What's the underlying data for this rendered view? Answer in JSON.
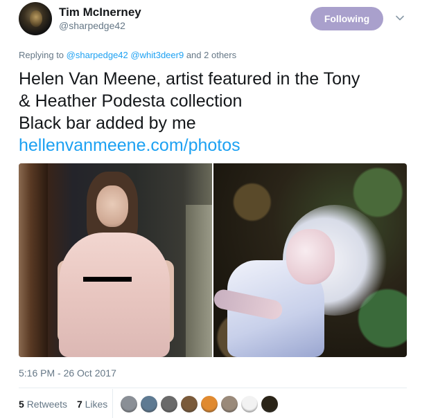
{
  "author": {
    "name": "Tim McInerney",
    "handle": "@sharpedge42"
  },
  "follow_button_label": "Following",
  "reply": {
    "prefix": "Replying to",
    "mentions": [
      "@sharpedge42",
      "@whit3deer9"
    ],
    "suffix": "and 2 others"
  },
  "tweet": {
    "lines": [
      "Helen Van Meene, artist featured in the Tony",
      "& Heather Podesta collection",
      "Black bar added by me"
    ],
    "link": "hellenvanmeene.com/photos"
  },
  "timestamp": "5:16 PM - 26 Oct 2017",
  "stats": {
    "retweets_count": "5",
    "retweets_label": "Retweets",
    "likes_count": "7",
    "likes_label": "Likes"
  },
  "liker_avatars": [
    "#8a8f96",
    "#5e7a92",
    "#6a6a6a",
    "#7a5a3a",
    "#e08a30",
    "#9a8a7a",
    "#f2f2f2",
    "#2a2418"
  ],
  "colors": {
    "link": "#1da1f2",
    "follow_button": "#a9a0cc",
    "secondary_text": "#657786"
  }
}
